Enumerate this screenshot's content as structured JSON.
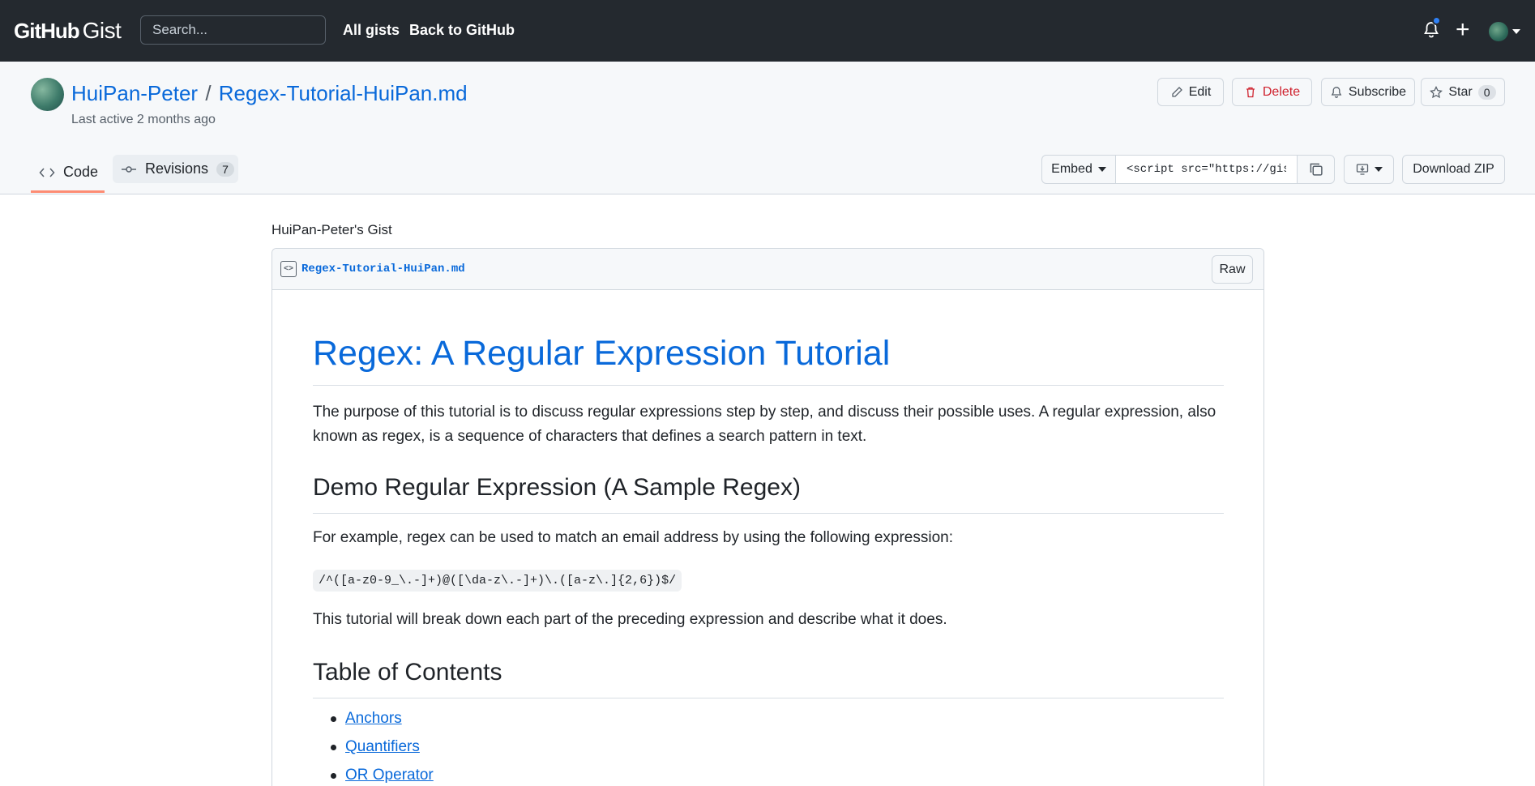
{
  "header": {
    "logo_brand": "GitHub",
    "logo_product": "Gist",
    "search_placeholder": "Search...",
    "links": [
      "All gists",
      "Back to GitHub"
    ]
  },
  "gist": {
    "owner": "HuiPan-Peter",
    "separator": "/",
    "filename": "Regex-Tutorial-HuiPan.md",
    "last_active": "Last active 2 months ago",
    "actions": {
      "edit": "Edit",
      "delete": "Delete",
      "subscribe": "Subscribe",
      "star": "Star",
      "star_count": "0"
    },
    "tabs": {
      "code": "Code",
      "revisions": "Revisions",
      "revisions_count": "7"
    },
    "embed": {
      "label": "Embed",
      "value": "<script src=\"https://gist.github.com/HuiPan-Peter/"
    },
    "download_zip": "Download ZIP"
  },
  "content": {
    "owner_gist_label": "HuiPan-Peter's Gist",
    "file_name": "Regex-Tutorial-HuiPan.md",
    "raw": "Raw",
    "h1": "Regex: A Regular Expression Tutorial",
    "intro": "The purpose of this tutorial is to discuss regular expressions step by step, and discuss their possible uses. A regular expression, also known as regex, is a sequence of characters that defines a search pattern in text.",
    "h2_demo": "Demo Regular Expression (A Sample Regex)",
    "demo_text": "For example, regex can be used to match an email address by using the following expression:",
    "regex_code": "/^([a-z0-9_\\.-]+)@([\\da-z\\.-]+)\\.([a-z\\.]{2,6})$/",
    "breakdown_text": "This tutorial will break down each part of the preceding expression and describe what it does.",
    "h2_toc": "Table of Contents",
    "toc": [
      "Anchors",
      "Quantifiers",
      "OR Operator"
    ]
  },
  "colors": {
    "header_bg": "#24292f",
    "link_blue": "#0969da",
    "danger": "#cf222e",
    "tab_underline": "#fd8c73"
  }
}
